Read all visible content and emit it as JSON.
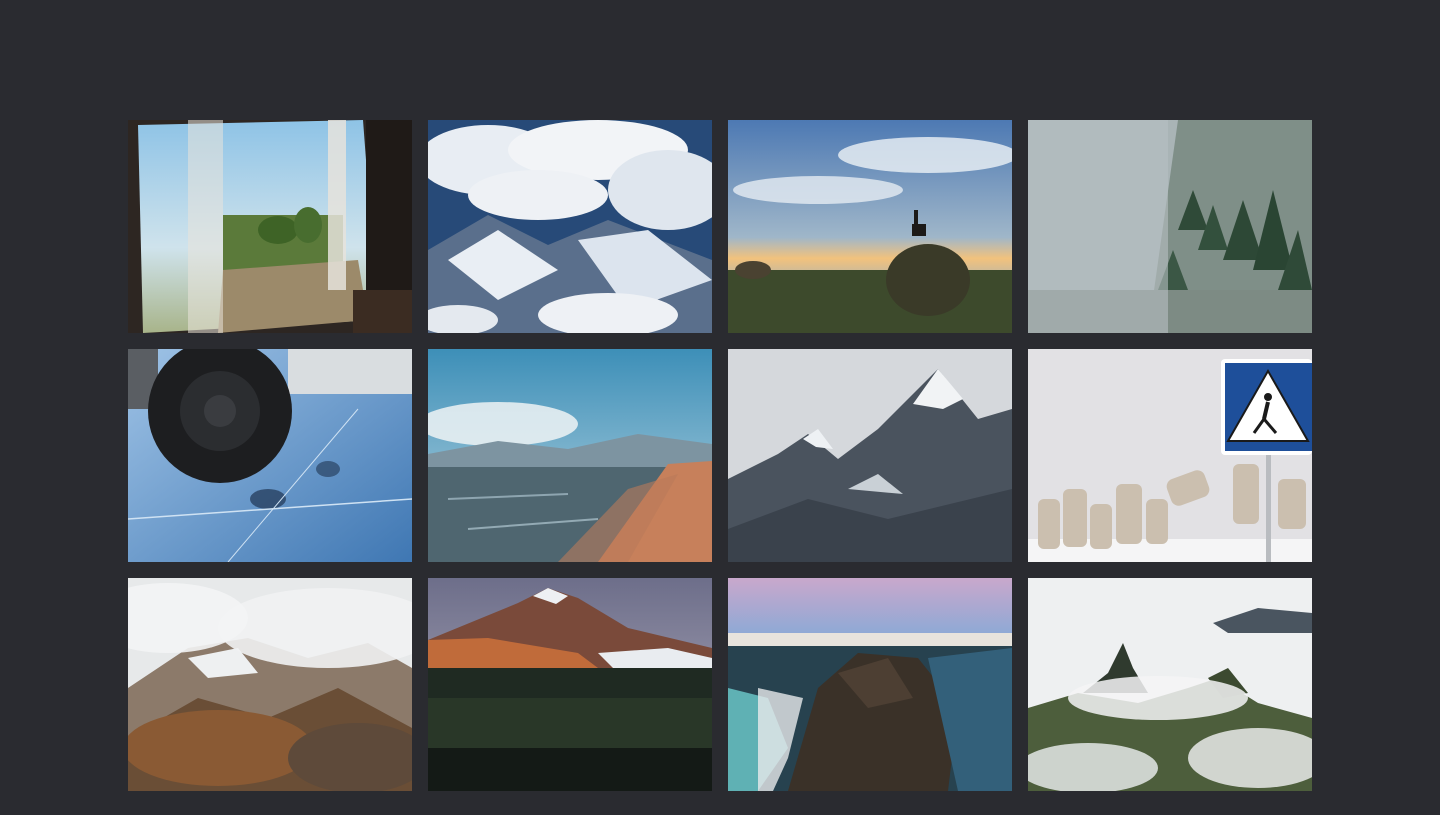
{
  "gallery": {
    "photos": [
      {
        "subject": "train-window-view"
      },
      {
        "subject": "clouds-over-mountains"
      },
      {
        "subject": "dog-on-hay-bale-at-sunrise"
      },
      {
        "subject": "misty-pine-forest"
      },
      {
        "subject": "car-wheel-on-ice"
      },
      {
        "subject": "lake-shore-beach"
      },
      {
        "subject": "snowy-mountain-peaks"
      },
      {
        "subject": "pedestrian-crossing-sign-tetrapods"
      },
      {
        "subject": "foggy-volcanic-hills"
      },
      {
        "subject": "volcano-at-dusk"
      },
      {
        "subject": "rocky-coastline-cliff"
      },
      {
        "subject": "mountain-peaks-above-clouds"
      }
    ]
  }
}
